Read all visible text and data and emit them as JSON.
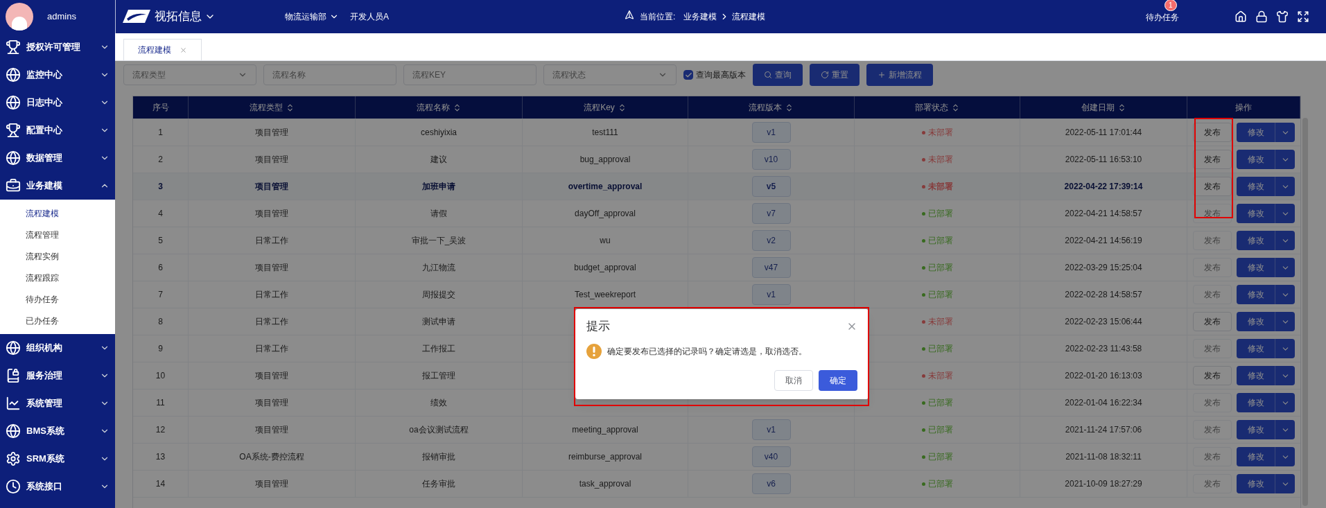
{
  "user": {
    "name": "admins"
  },
  "topbar": {
    "brand": "视拓信息",
    "department": "物流运输部",
    "role": "开发人员A",
    "location_label": "当前位置:",
    "breadcrumb": [
      "业务建模",
      "流程建模"
    ],
    "todo": {
      "label": "待办任务",
      "badge": "1"
    }
  },
  "sidebar": {
    "items": [
      {
        "label": "授权许可管理",
        "kind": "trophy",
        "expanded": false
      },
      {
        "label": "监控中心",
        "kind": "globe",
        "expanded": false
      },
      {
        "label": "日志中心",
        "kind": "globe",
        "expanded": false
      },
      {
        "label": "配置中心",
        "kind": "trophy",
        "expanded": false
      },
      {
        "label": "数据管理",
        "kind": "globe",
        "expanded": false
      },
      {
        "label": "业务建模",
        "kind": "case",
        "expanded": true,
        "children": [
          {
            "label": "流程建模",
            "selected": true
          },
          {
            "label": "流程管理",
            "selected": false
          },
          {
            "label": "流程实例",
            "selected": false
          },
          {
            "label": "流程跟踪",
            "selected": false
          },
          {
            "label": "待办任务",
            "selected": false
          },
          {
            "label": "已办任务",
            "selected": false
          }
        ]
      },
      {
        "label": "组织机构",
        "kind": "globe",
        "expanded": false
      },
      {
        "label": "服务治理",
        "kind": "book",
        "expanded": false
      },
      {
        "label": "系统管理",
        "kind": "chart",
        "expanded": false
      },
      {
        "label": "BMS系统",
        "kind": "globe",
        "expanded": false
      },
      {
        "label": "SRM系统",
        "kind": "gear",
        "expanded": false
      },
      {
        "label": "系统接口",
        "kind": "clock",
        "expanded": false
      }
    ]
  },
  "tabs": [
    {
      "label": "流程建模",
      "selected": true
    }
  ],
  "filters": {
    "type": {
      "placeholder": "流程类型"
    },
    "name": {
      "placeholder": "流程名称"
    },
    "key": {
      "placeholder": "流程KEY"
    },
    "status": {
      "placeholder": "流程状态"
    },
    "latest_only": {
      "label": "查询最高版本",
      "checked": true
    },
    "buttons": [
      {
        "label": "查询",
        "kind": "search"
      },
      {
        "label": "重置",
        "kind": "reset"
      },
      {
        "label": "新增流程",
        "kind": "plus"
      }
    ]
  },
  "table": {
    "columns": [
      {
        "label": "序号",
        "sortable": false
      },
      {
        "label": "流程类型",
        "sortable": true
      },
      {
        "label": "流程名称",
        "sortable": true
      },
      {
        "label": "流程Key",
        "sortable": true
      },
      {
        "label": "流程版本",
        "sortable": true
      },
      {
        "label": "部署状态",
        "sortable": true
      },
      {
        "label": "创建日期",
        "sortable": true
      },
      {
        "label": "操作",
        "sortable": false
      }
    ],
    "rows": [
      {
        "no": "1",
        "type": "项目管理",
        "name": "ceshiyixia",
        "key": "test111",
        "version": "v1",
        "status": "未部署",
        "deployed": false,
        "date": "2022-05-11 17:01:44",
        "publish_label": "发布",
        "publish_disabled": false,
        "edit_label": "修改",
        "hovered": false
      },
      {
        "no": "2",
        "type": "项目管理",
        "name": "建议",
        "key": "bug_approval",
        "version": "v10",
        "status": "未部署",
        "deployed": false,
        "date": "2022-05-11 16:53:10",
        "publish_label": "发布",
        "publish_disabled": false,
        "edit_label": "修改",
        "hovered": false
      },
      {
        "no": "3",
        "type": "项目管理",
        "name": "加班申请",
        "key": "overtime_approval",
        "version": "v5",
        "status": "未部署",
        "deployed": false,
        "date": "2022-04-22 17:39:14",
        "publish_label": "发布",
        "publish_disabled": false,
        "edit_label": "修改",
        "hovered": true
      },
      {
        "no": "4",
        "type": "项目管理",
        "name": "请假",
        "key": "dayOff_approval",
        "version": "v7",
        "status": "已部署",
        "deployed": true,
        "date": "2022-04-21 14:58:57",
        "publish_label": "发布",
        "publish_disabled": true,
        "edit_label": "修改",
        "hovered": false
      },
      {
        "no": "5",
        "type": "日常工作",
        "name": "审批一下_吴波",
        "key": "wu",
        "version": "v2",
        "status": "已部署",
        "deployed": true,
        "date": "2022-04-21 14:56:19",
        "publish_label": "发布",
        "publish_disabled": true,
        "edit_label": "修改",
        "hovered": false
      },
      {
        "no": "6",
        "type": "项目管理",
        "name": "九江物流",
        "key": "budget_approval",
        "version": "v47",
        "status": "已部署",
        "deployed": true,
        "date": "2022-03-29 15:25:04",
        "publish_label": "发布",
        "publish_disabled": true,
        "edit_label": "修改",
        "hovered": false
      },
      {
        "no": "7",
        "type": "日常工作",
        "name": "周报提交",
        "key": "Test_weekreport",
        "version": "v1",
        "status": "已部署",
        "deployed": true,
        "date": "2022-02-28 14:58:57",
        "publish_label": "发布",
        "publish_disabled": true,
        "edit_label": "修改",
        "hovered": false
      },
      {
        "no": "8",
        "type": "日常工作",
        "name": "测试申请",
        "status": "未部署",
        "deployed": false,
        "date": "2022-02-23 15:06:44",
        "publish_label": "发布",
        "publish_disabled": false,
        "edit_label": "修改",
        "hovered": false
      },
      {
        "no": "9",
        "type": "日常工作",
        "name": "工作报工",
        "status": "已部署",
        "deployed": true,
        "date": "2022-02-23 11:43:58",
        "publish_label": "发布",
        "publish_disabled": true,
        "edit_label": "修改",
        "hovered": false
      },
      {
        "no": "10",
        "type": "项目管理",
        "name": "报工管理",
        "status": "未部署",
        "deployed": false,
        "date": "2022-01-20 16:13:03",
        "publish_label": "发布",
        "publish_disabled": false,
        "edit_label": "修改",
        "hovered": false
      },
      {
        "no": "11",
        "type": "项目管理",
        "name": "绩效",
        "status": "已部署",
        "deployed": true,
        "date": "2022-01-04 16:22:34",
        "publish_label": "发布",
        "publish_disabled": true,
        "edit_label": "修改",
        "hovered": false
      },
      {
        "no": "12",
        "type": "项目管理",
        "name": "oa会议测试流程",
        "key": "meeting_approval",
        "version": "v1",
        "status": "已部署",
        "deployed": true,
        "date": "2021-11-24 17:57:06",
        "publish_label": "发布",
        "publish_disabled": true,
        "edit_label": "修改",
        "hovered": false
      },
      {
        "no": "13",
        "type": "OA系统-费控流程",
        "name": "报销审批",
        "key": "reimburse_approval",
        "version": "v40",
        "status": "已部署",
        "deployed": true,
        "date": "2021-11-08 18:32:11",
        "publish_label": "发布",
        "publish_disabled": true,
        "edit_label": "修改",
        "hovered": false
      },
      {
        "no": "14",
        "type": "项目管理",
        "name": "任务审批",
        "key": "task_approval",
        "version": "v6",
        "status": "已部署",
        "deployed": true,
        "date": "2021-10-09 18:27:29",
        "publish_label": "发布",
        "publish_disabled": true,
        "edit_label": "修改",
        "hovered": false
      }
    ]
  },
  "dialog": {
    "title": "提示",
    "message": "确定要发布已选择的记录吗？确定请选是，取消选否。",
    "buttons": [
      {
        "label": "取消",
        "primary": false
      },
      {
        "label": "确定",
        "primary": true
      }
    ]
  }
}
